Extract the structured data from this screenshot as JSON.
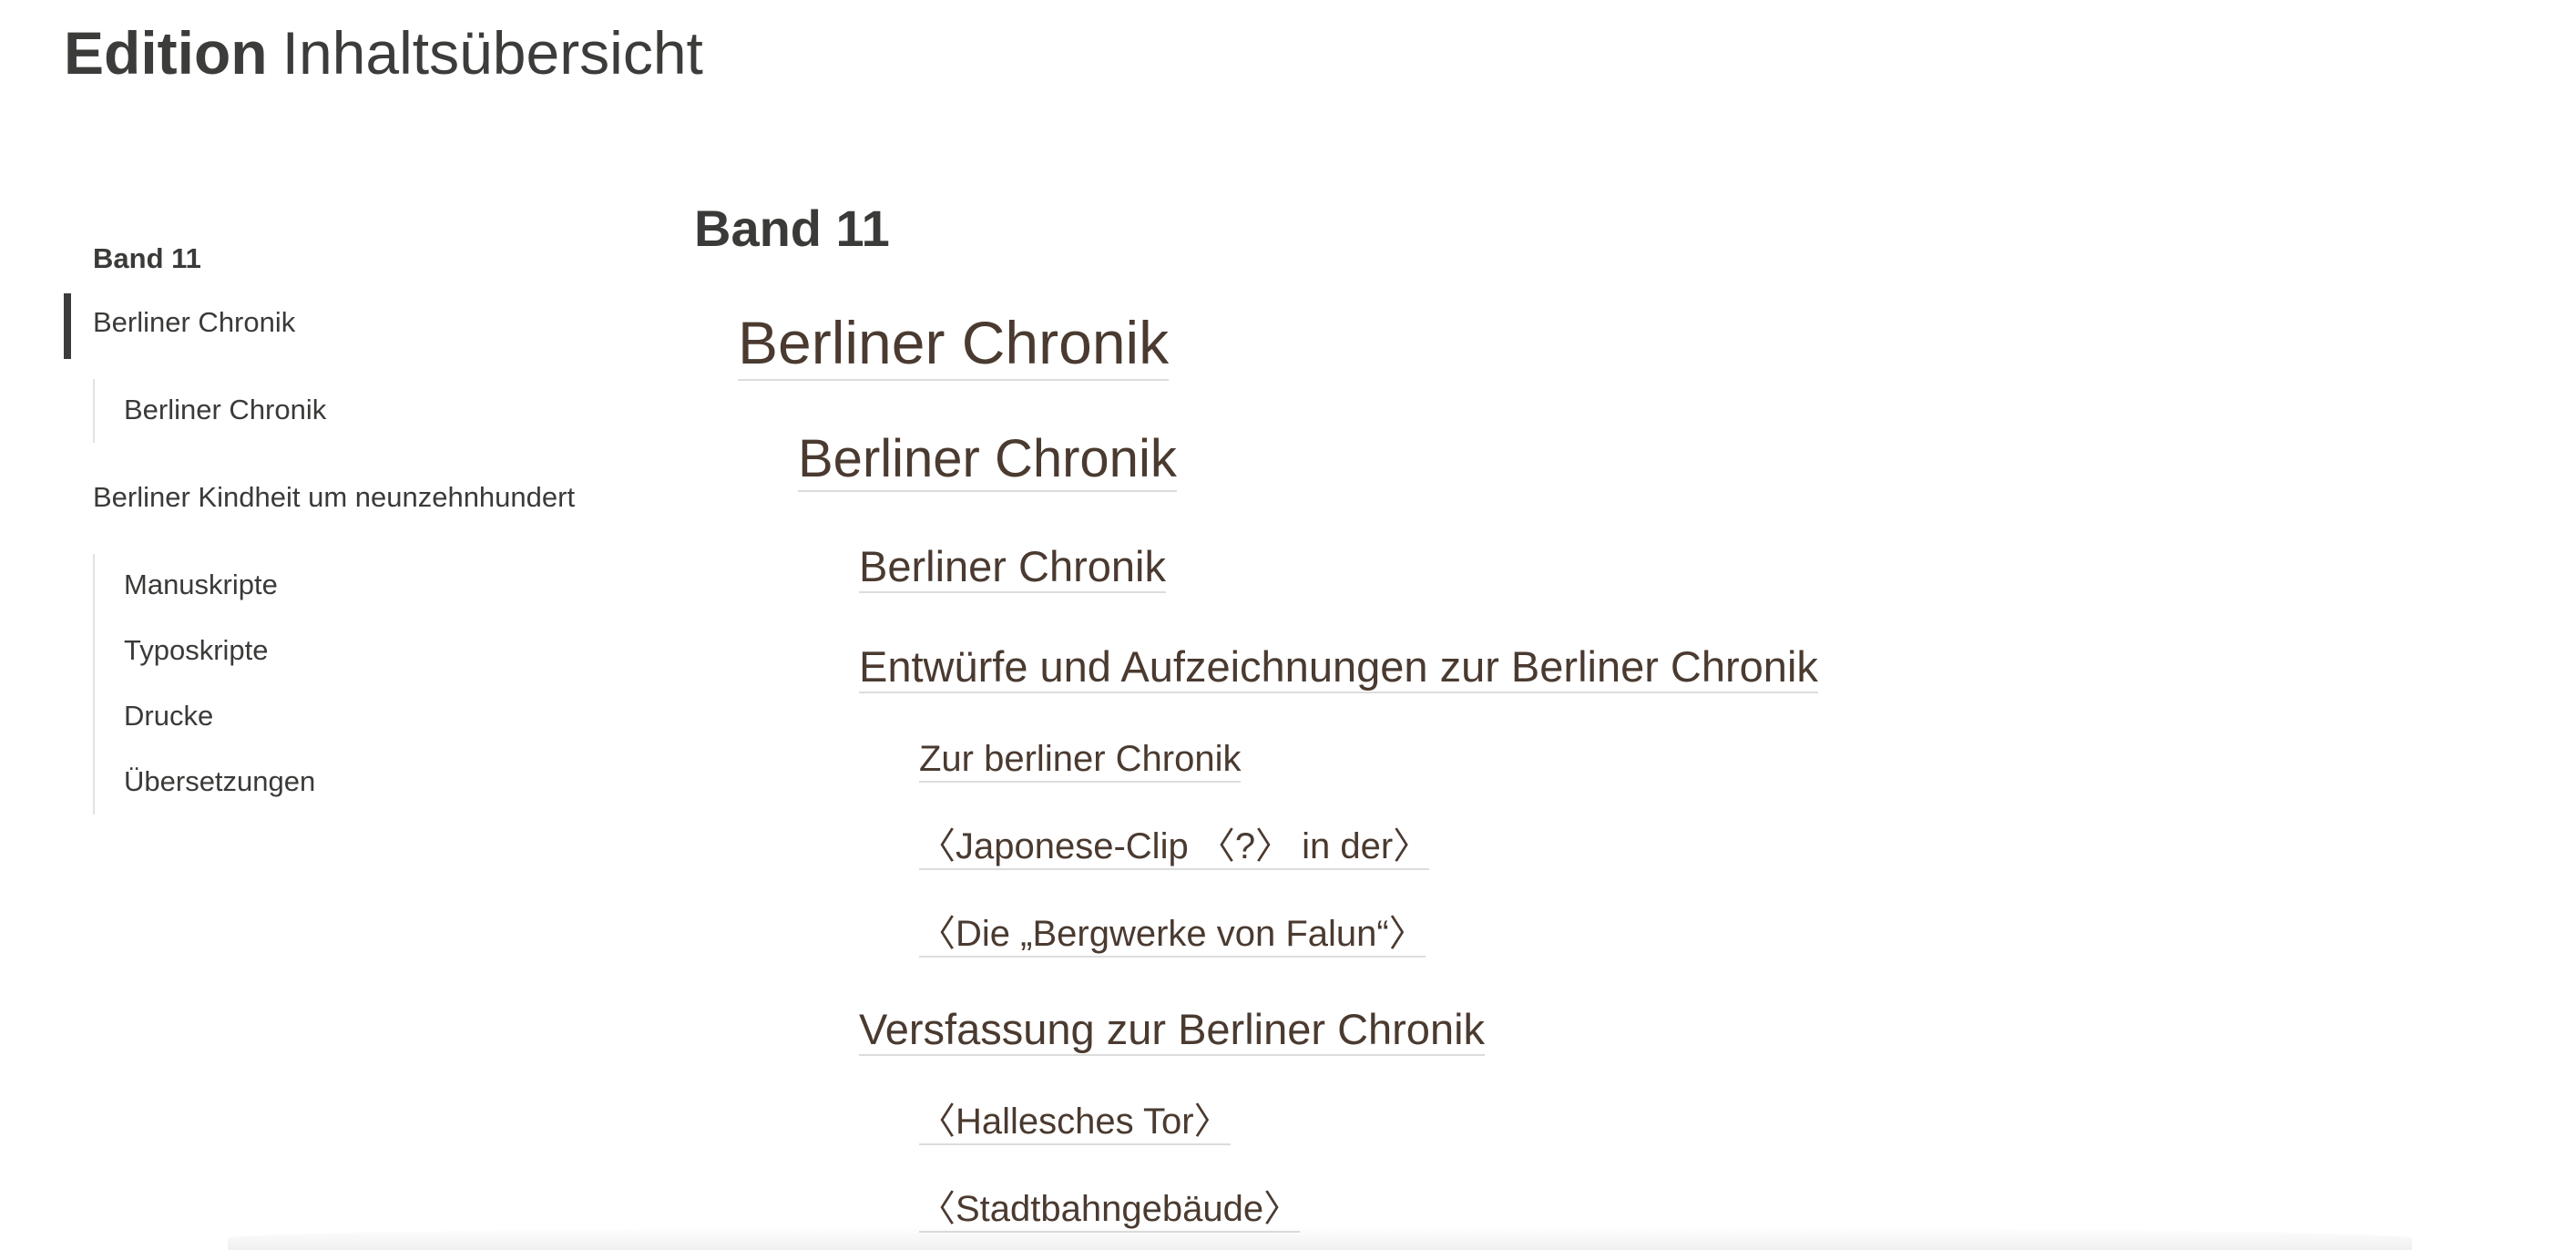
{
  "header": {
    "strong": "Edition",
    "light": "Inhaltsübersicht"
  },
  "sidebar": {
    "title": "Band 11",
    "items": [
      {
        "label": "Berliner Chronik",
        "active": true
      },
      {
        "label": "Berliner Chronik"
      },
      {
        "label": "Berliner Kindheit um neunzehnhundert"
      },
      {
        "label": "Manuskripte"
      },
      {
        "label": "Typoskripte"
      },
      {
        "label": "Drucke"
      },
      {
        "label": "Übersetzungen"
      }
    ]
  },
  "main": {
    "title": "Band 11",
    "entries": [
      "Berliner Chronik",
      "Berliner Chronik",
      "Berliner Chronik",
      "Entwürfe und Aufzeichnungen zur Berliner Chronik",
      "Zur berliner Chronik",
      "〈Japonese-Clip 〈?〉 in der〉",
      "〈Die „Bergwerke von Falun“〉",
      "Versfassung zur Berliner Chronik",
      "〈Hallesches Tor〉",
      "〈Stadtbahngebäude〉"
    ]
  },
  "colors": {
    "text": "#3a3a38",
    "link": "#4a3a30",
    "underline": "#dcdcdc",
    "active_bar": "#3c3c3a"
  }
}
